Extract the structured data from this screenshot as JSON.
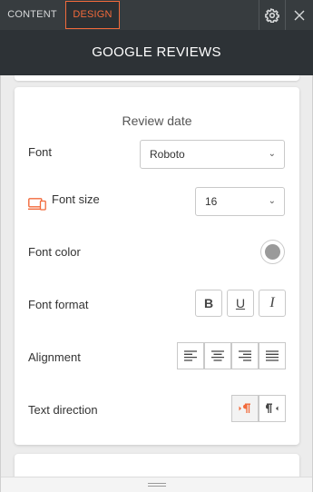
{
  "tabs": {
    "content": "CONTENT",
    "design": "DESIGN"
  },
  "header": {
    "title": "GOOGLE REVIEWS"
  },
  "section": {
    "title": "Review date",
    "font_label": "Font",
    "font_value": "Roboto",
    "font_size_label": "Font size",
    "font_size_value": "16",
    "font_color_label": "Font color",
    "font_color": "#9a9a9a",
    "font_format_label": "Font format",
    "format_buttons": [
      "B",
      "U",
      "I"
    ],
    "alignment_label": "Alignment",
    "text_direction_label": "Text direction",
    "text_direction_selected": "ltr"
  },
  "colors": {
    "accent": "#f26a3b",
    "topbar": "#373c3f",
    "titlebar": "#2d3236"
  }
}
